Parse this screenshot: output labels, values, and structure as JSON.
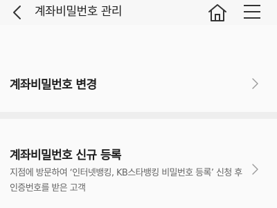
{
  "header": {
    "title": "계좌비밀번호 관리",
    "icons": {
      "back": "back-arrow-icon",
      "home": "home-icon",
      "menu": "hamburger-menu-icon"
    }
  },
  "items": [
    {
      "title": "계좌비밀번호 변경",
      "description": ""
    },
    {
      "title": "계좌비밀번호 신규 등록",
      "description": "지점에 방문하여 ‘인터넷뱅킹, KB스타뱅킹 비밀번호 등록’ 신청 후 인증번호를 받은 고객"
    }
  ],
  "colors": {
    "background": "#f7f7f7",
    "divider": "#eeeeee",
    "text": "#222222",
    "subtext": "#666666"
  }
}
